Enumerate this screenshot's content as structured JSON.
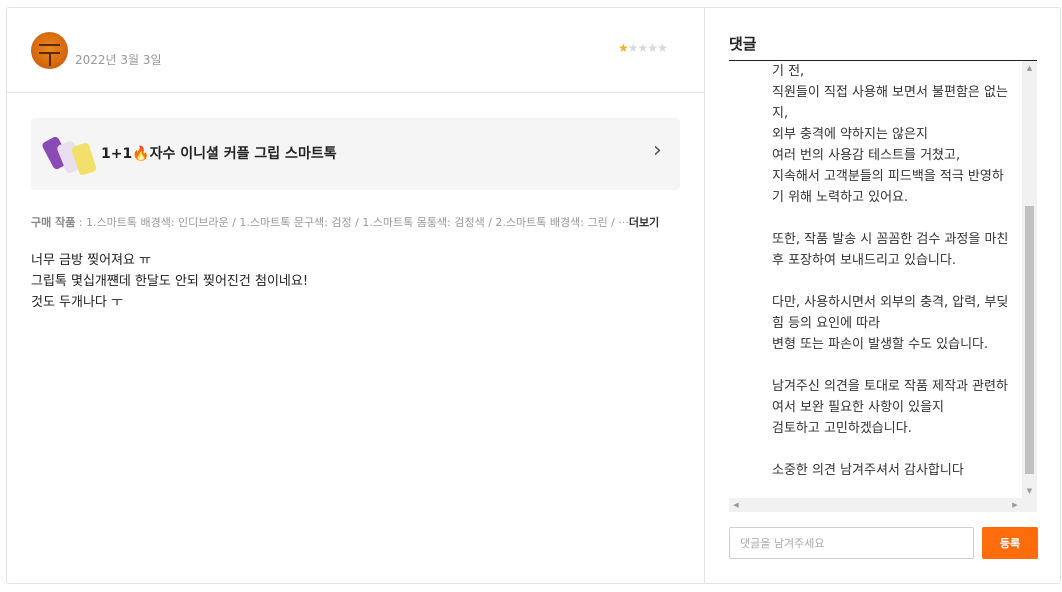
{
  "review": {
    "date": "2022년 3월 3일",
    "rating": 1,
    "rating_max": 5,
    "product": {
      "name": "1+1🔥자수 이니셜 커플 그립 스마트톡"
    },
    "options": {
      "label": "구매 작품",
      "text": " : 1.스마트톡 배경색: 인디브라운 / 1.스마트톡 문구색: 검정 / 1.스마트톡 몸통색: 검정색 / 2.스마트톡 배경색: 그린 / ···",
      "more_label": "더보기"
    },
    "body_lines": [
      "너무 금방 찢어져요 ㅠ",
      "그립톡 몇십개쨴데 한달도 안되 찢어진건 첨이네요!",
      "것도 두개나다 ㅜ"
    ]
  },
  "comments": {
    "title": "댓글",
    "lines": [
      "기 전,",
      "직원들이 직접 사용해 보면서 불편함은 없는",
      "지,",
      "외부 충격에 약하지는 않은지",
      "여러 번의 사용감 테스트를 거쳤고,",
      "지속해서 고객분들의 피드백을 적극 반영하",
      "기 위해 노력하고 있어요.",
      "",
      "또한, 작품 발송 시 꼼꼼한 검수 과정을 마친",
      "후 포장하여 보내드리고 있습니다.",
      "",
      "다만, 사용하시면서 외부의 충격, 압력, 부딪",
      "힘 등의 요인에 따라",
      "변형 또는 파손이 발생할 수도 있습니다.",
      "",
      "남겨주신 의견을 토대로 작품 제작과 관련하",
      "여서 보완 필요한 사항이 있을지",
      "검토하고 고민하겠습니다.",
      "",
      "소중한 의견 남겨주셔서 감사합니다"
    ],
    "input": {
      "placeholder": "댓글을 남겨주세요",
      "value": ""
    },
    "submit_label": "등록"
  },
  "colors": {
    "accent": "#ff6c0b",
    "star_on": "#f5b31b",
    "star_off": "#d9d9d9"
  }
}
